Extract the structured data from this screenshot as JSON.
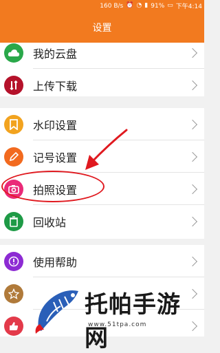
{
  "status_bar": {
    "speed": "160 B/s",
    "battery": "91%",
    "time": "下午4:14"
  },
  "header": {
    "title": "设置"
  },
  "menu": {
    "group1": [
      {
        "label": "我的云盘",
        "icon": "cloud-icon",
        "color": "#2aa84a"
      },
      {
        "label": "上传下载",
        "icon": "transfer-icon",
        "color": "#b5122b"
      }
    ],
    "group2": [
      {
        "label": "水印设置",
        "icon": "bookmark-icon",
        "color": "#f2a31f"
      },
      {
        "label": "记号设置",
        "icon": "pencil-icon",
        "color": "#f26a1f"
      },
      {
        "label": "拍照设置",
        "icon": "camera-icon",
        "color": "#ea2a78"
      },
      {
        "label": "回收站",
        "icon": "trash-icon",
        "color": "#1e9a46"
      }
    ],
    "group3": [
      {
        "label": "使用帮助",
        "icon": "help-icon",
        "color": "#8d2bd3"
      },
      {
        "label": "",
        "icon": "star-icon",
        "color": "#b07a3a"
      },
      {
        "label": "",
        "icon": "thumbs-up-icon",
        "color": "#e33a4a"
      }
    ]
  },
  "watermark": {
    "text": "托帕手游网",
    "url": "www.51tpa.com"
  },
  "colors": {
    "accent": "#f27a1f",
    "annotation": "#e0191f"
  }
}
